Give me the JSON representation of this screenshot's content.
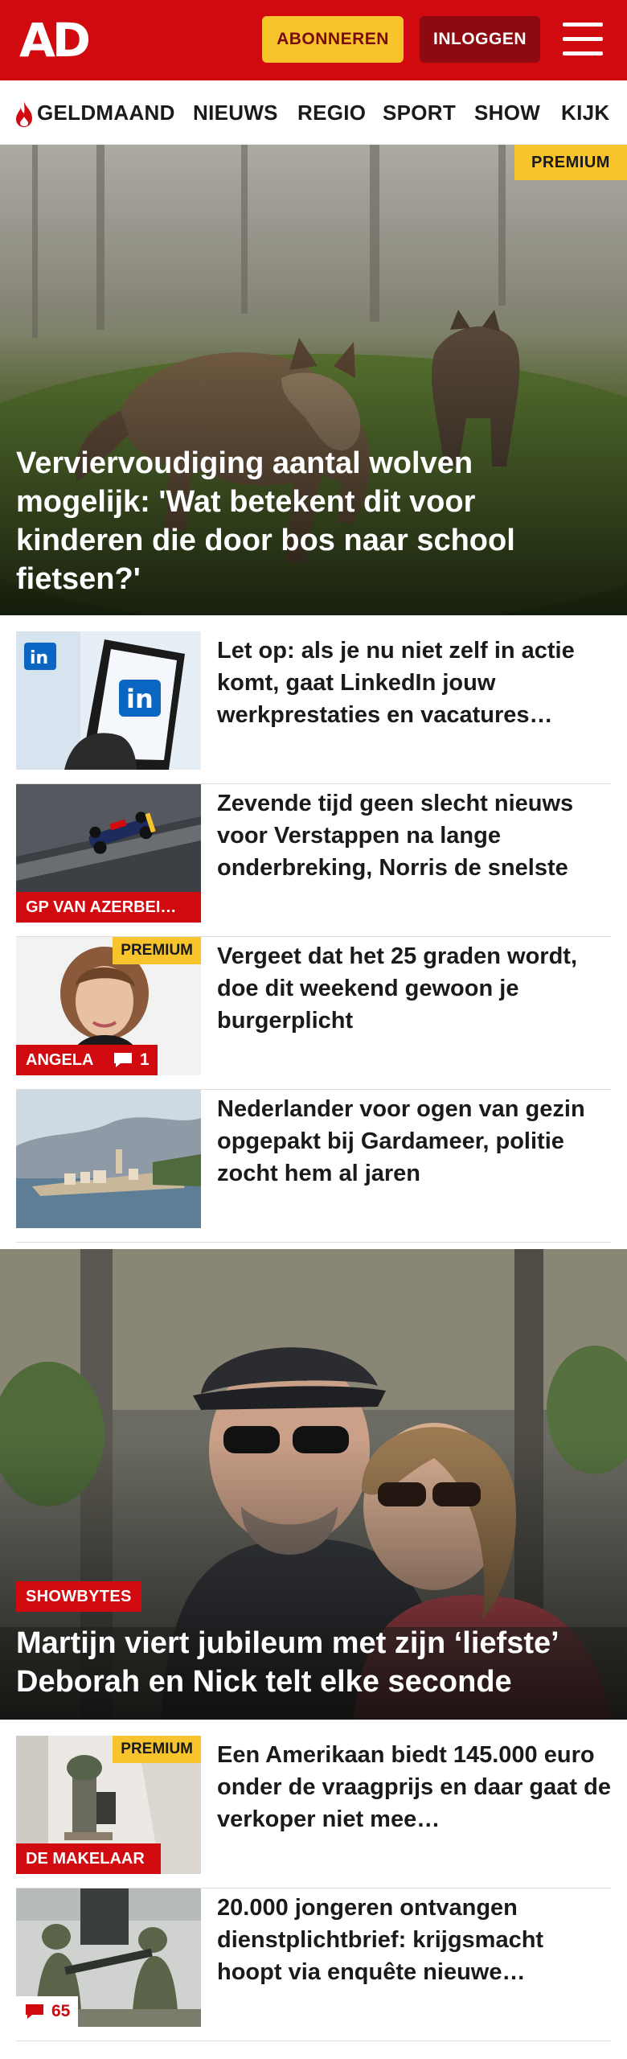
{
  "header": {
    "logo": "AD",
    "subscribe_label": "ABONNEREN",
    "login_label": "INLOGGEN"
  },
  "nav": {
    "items": [
      "GELDMAAND",
      "NIEUWS",
      "REGIO",
      "SPORT",
      "SHOW",
      "KIJK"
    ]
  },
  "hero1": {
    "badge": "PREMIUM",
    "title": "Verviervoudiging aantal wolven mogelijk: 'Wat betekent dit voor kinderen die door bos naar school fietsen?'"
  },
  "articles1": [
    {
      "title": "Let op: als je nu niet zelf in actie komt, gaat LinkedIn jouw werkprestaties en vacatures…",
      "tag": "",
      "premium": "",
      "comments": ""
    },
    {
      "title": "Zevende tijd geen slecht nieuws voor Verstappen na lange onderbreking, Norris de snelste",
      "tag": "GP VAN AZERBEI…",
      "premium": "",
      "comments": ""
    },
    {
      "title": "Vergeet dat het 25 graden wordt, doe dit weekend gewoon je burgerplicht",
      "tag": "ANGELA",
      "premium": "PREMIUM",
      "comments": "1"
    },
    {
      "title": "Nederlander voor ogen van gezin opgepakt bij Gardameer, politie zocht hem al jaren",
      "tag": "",
      "premium": "",
      "comments": ""
    }
  ],
  "hero2": {
    "tag": "SHOWBYTES",
    "title": "Martijn viert jubileum met zijn ‘liefste’ Deborah en Nick telt elke seconde"
  },
  "articles2": [
    {
      "title": "Een Amerikaan biedt 145.000 euro onder de vraagprijs en daar gaat de verkoper niet mee…",
      "tag": "DE MAKELAAR",
      "premium": "PREMIUM",
      "comments": ""
    },
    {
      "title": "20.000 jongeren ontvangen dienstplichtbrief: krijgsmacht hoopt via enquête nieuwe…",
      "tag": "",
      "premium": "",
      "comments": "65"
    }
  ],
  "colors": {
    "brand_red": "#d10a10",
    "premium_yellow": "#f8c42c",
    "login_dark_red": "#8f0a10"
  }
}
